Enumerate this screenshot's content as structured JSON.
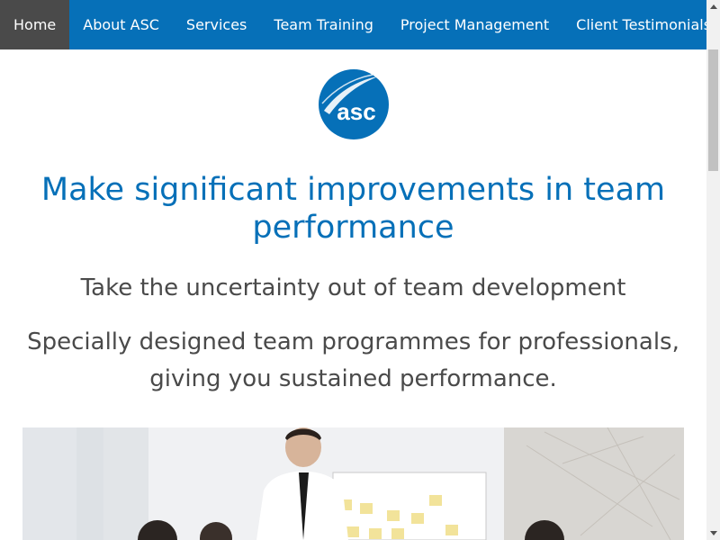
{
  "nav": {
    "items": [
      {
        "label": "Home",
        "active": true
      },
      {
        "label": "About ASC"
      },
      {
        "label": "Services"
      },
      {
        "label": "Team Training"
      },
      {
        "label": "Project Management"
      },
      {
        "label": "Client Testimonials"
      }
    ]
  },
  "logo": {
    "text": "asc"
  },
  "main": {
    "headline": "Make significant improvements in team performance",
    "subheadline": "Take the uncertainty out of team development",
    "description": "Specially designed team programmes for professionals, giving you sustained performance."
  },
  "colors": {
    "brand": "#0670b8",
    "active_nav": "#4a4a4a",
    "text": "#4a4a4a"
  }
}
